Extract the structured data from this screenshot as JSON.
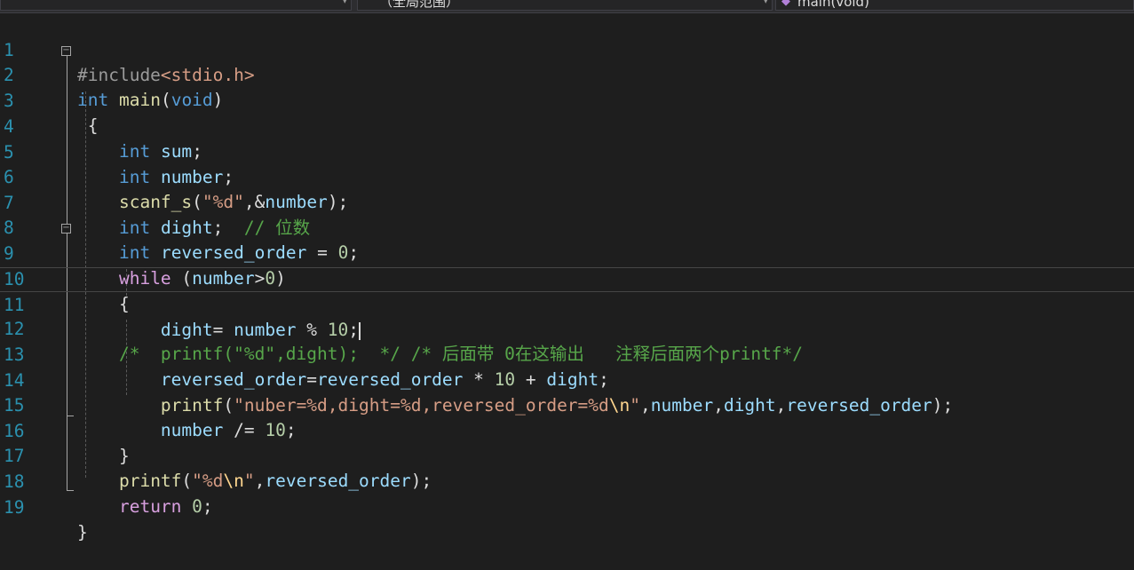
{
  "toolbar": {
    "scope_dropdown": "（全局范围）",
    "function_dropdown": "main(void)"
  },
  "line_numbers": [
    "1",
    "2",
    "3",
    "4",
    "5",
    "6",
    "7",
    "8",
    "9",
    "10",
    "11",
    "12",
    "13",
    "14",
    "15",
    "16",
    "17",
    "18",
    "19"
  ],
  "code": {
    "l1": {
      "pre": "#include",
      "inc": "<stdio.h>"
    },
    "l2": {
      "kw": "int",
      "fn": "main",
      "open": "(",
      "kw2": "void",
      "close": ")"
    },
    "l3": {
      "brace": "{"
    },
    "l4": {
      "kw": "int",
      "var": "sum",
      "semi": ";"
    },
    "l5": {
      "kw": "int",
      "var": "number",
      "semi": ";"
    },
    "l6": {
      "fn": "scanf_s",
      "open": "(",
      "str": "\"%d\"",
      "comma": ",&",
      "var": "number",
      "close": ");"
    },
    "l7": {
      "kw": "int",
      "var": "dight",
      "semi": ";",
      "cm": "// 位数"
    },
    "l8": {
      "kw": "int",
      "var": "reversed_order",
      "eq": " = ",
      "num": "0",
      "semi": ";"
    },
    "l9": {
      "ctl": "while",
      "open": " (",
      "var": "number",
      "op": ">",
      "num": "0",
      "close": ")"
    },
    "l10": {
      "brace": "{"
    },
    "l11": {
      "var": "dight",
      "eq": "= ",
      "var2": "number",
      "op": " % ",
      "num": "10",
      "semi": ";"
    },
    "l12": {
      "cm": "/*  printf(\"%d\",dight);  */ /* 后面带 0在这输出   注释后面两个printf*/"
    },
    "l13": {
      "var": "reversed_order",
      "eq": "=",
      "var2": "reversed_order",
      "op": " * ",
      "num": "10",
      "op2": " + ",
      "var3": "dight",
      "semi": ";"
    },
    "l14": {
      "fn": "printf",
      "open": "(",
      "str1": "\"nuber=%d,dight=%d,reversed_order=%d",
      "esc": "\\n",
      "str2": "\"",
      "c1": ",",
      "v1": "number",
      "c2": ",",
      "v2": "dight",
      "c3": ",",
      "v3": "reversed_order",
      "close": ");"
    },
    "l15": {
      "var": "number",
      "op": " /= ",
      "num": "10",
      "semi": ";"
    },
    "l16": {
      "brace": "}"
    },
    "l17": {
      "fn": "printf",
      "open": "(",
      "str1": "\"%d",
      "esc": "\\n",
      "str2": "\"",
      "comma": ",",
      "var": "reversed_order",
      "close": ");"
    },
    "l18": {
      "ctl": "return",
      "num": " 0",
      "semi": ";"
    },
    "l19": {
      "brace": "}"
    }
  }
}
